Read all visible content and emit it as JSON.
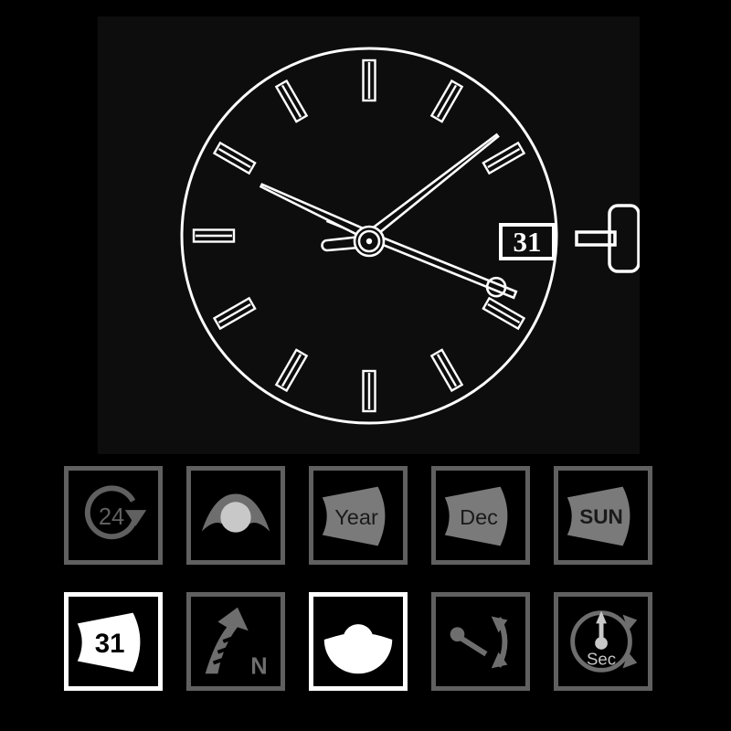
{
  "theme": {
    "background": "#000000",
    "panel_background": "#0d0d0d",
    "line_color": "#ffffff",
    "icon_gray": "#606060",
    "icon_gray_light": "#c8c8c8",
    "icon_active": "#ffffff"
  },
  "watch": {
    "name": "analog-watch-dial",
    "date_window_value": "31",
    "hands": {
      "hour_angle_deg": 295,
      "minute_angle_deg": 52,
      "second_angle_deg": 112
    },
    "hour_marker_count": 12,
    "crown_label": "crown"
  },
  "icons": {
    "rows": [
      [
        {
          "name": "24-hour-icon",
          "label": "24",
          "state": "inactive"
        },
        {
          "name": "moon-phase-icon",
          "label": "",
          "state": "inactive"
        },
        {
          "name": "year-disc-icon",
          "label": "Year",
          "state": "inactive"
        },
        {
          "name": "month-disc-icon",
          "label": "Dec",
          "state": "inactive"
        },
        {
          "name": "weekday-disc-icon",
          "label": "SUN",
          "state": "inactive"
        }
      ],
      [
        {
          "name": "date-disc-icon",
          "label": "31",
          "state": "active"
        },
        {
          "name": "north-arrow-icon",
          "label": "N",
          "state": "inactive"
        },
        {
          "name": "moon-disc-icon",
          "label": "",
          "state": "active"
        },
        {
          "name": "power-reserve-icon",
          "label": "",
          "state": "inactive"
        },
        {
          "name": "small-seconds-icon",
          "label": "Sec",
          "state": "inactive"
        }
      ]
    ]
  }
}
